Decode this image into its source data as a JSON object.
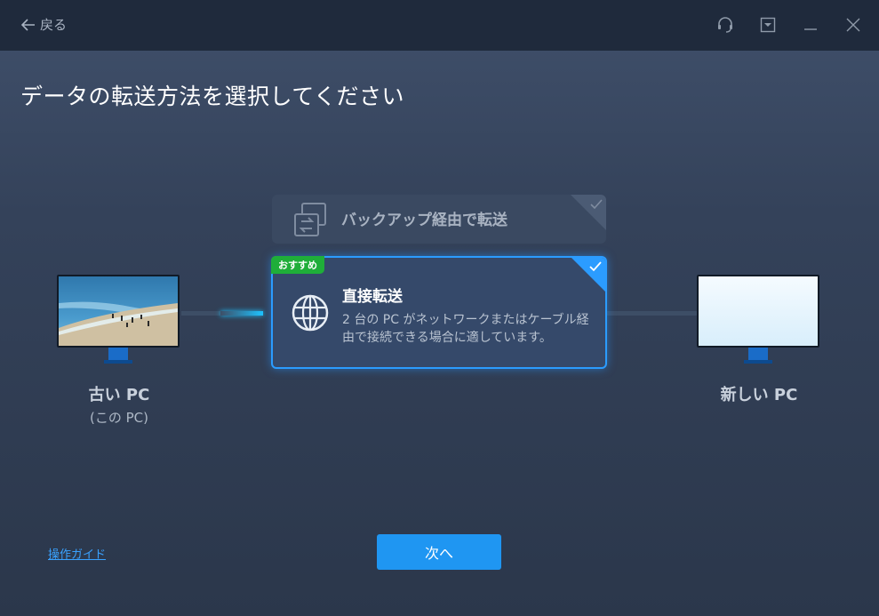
{
  "titlebar": {
    "back_label": "戻る",
    "icons": [
      "headset-icon",
      "dropdown-box-icon",
      "minimize-icon",
      "close-icon"
    ]
  },
  "heading": "データの転送方法を選択してください",
  "old_pc": {
    "label": "古い PC",
    "sublabel": "(この PC)"
  },
  "new_pc": {
    "label": "新しい PC"
  },
  "options": {
    "backup": {
      "title": "バックアップ経由で転送",
      "icon": "transfer-icon",
      "selected": false
    },
    "direct": {
      "badge": "おすすめ",
      "title": "直接転送",
      "description": "2 台の PC がネットワークまたはケーブル経由で接続できる場合に適しています。",
      "icon": "globe-icon",
      "selected": true
    }
  },
  "footer": {
    "guide_link": "操作ガイド",
    "next_button": "次へ"
  },
  "colors": {
    "accent": "#1f96f2",
    "selected_border": "#2b9cff",
    "badge": "#1fae39"
  }
}
